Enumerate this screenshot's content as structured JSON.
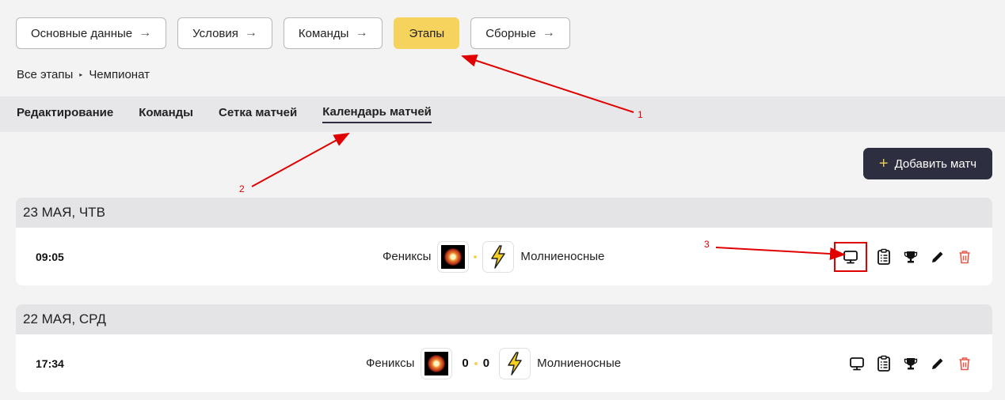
{
  "steps": [
    {
      "label": "Основные данные",
      "arrow": "→"
    },
    {
      "label": "Условия",
      "arrow": "→"
    },
    {
      "label": "Команды",
      "arrow": "→"
    },
    {
      "label": "Этапы"
    },
    {
      "label": "Сборные",
      "arrow": "→"
    }
  ],
  "breadcrumb": {
    "root": "Все этапы",
    "separator": "▸",
    "current": "Чемпионат"
  },
  "subtabs": [
    "Редактирование",
    "Команды",
    "Сетка матчей",
    "Календарь матчей"
  ],
  "add_button": {
    "plus": "+",
    "label": "Добавить матч"
  },
  "days": [
    {
      "date": "23 МАЯ, ЧТВ",
      "match": {
        "time": "09:05",
        "home": "Фениксы",
        "away": "Молниеносные",
        "score_home": "",
        "score_away": ""
      }
    },
    {
      "date": "22 МАЯ, СРД",
      "match": {
        "time": "17:34",
        "home": "Фениксы",
        "away": "Молниеносные",
        "score_home": "0",
        "score_away": "0"
      }
    }
  ],
  "annotations": [
    "1",
    "2",
    "3"
  ],
  "icons": [
    "monitor-icon",
    "clipboard-icon",
    "trophy-icon",
    "pencil-icon",
    "trash-icon",
    "arrow-right-icon",
    "plus-icon",
    "lightning-icon"
  ],
  "colors": {
    "accent_yellow": "#f5d35c",
    "dark_button": "#2d2e3f",
    "delete_red": "#e8584a",
    "annotation_red": "#e00000"
  }
}
